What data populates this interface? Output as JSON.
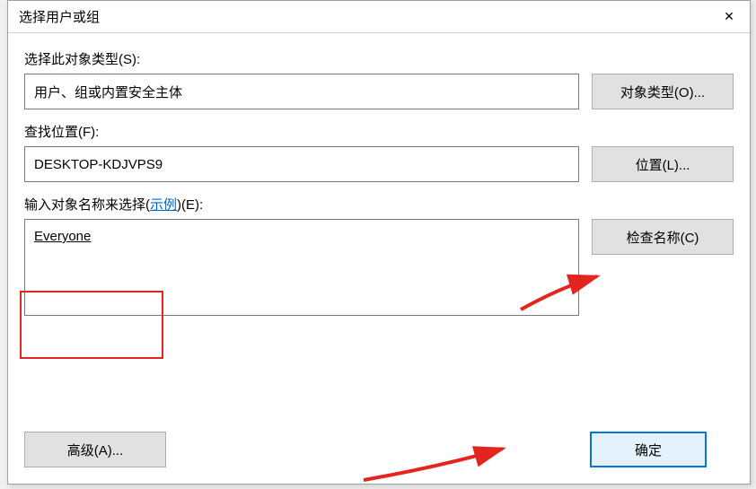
{
  "dialog": {
    "title": "选择用户或组",
    "close_icon": "✕"
  },
  "objectType": {
    "label": "选择此对象类型(S):",
    "value": "用户、组或内置安全主体",
    "button": "对象类型(O)..."
  },
  "location": {
    "label": "查找位置(F):",
    "value": "DESKTOP-KDJVPS9",
    "button": "位置(L)..."
  },
  "objectNames": {
    "label_prefix": "输入对象名称来选择(",
    "link": "示例",
    "label_suffix": ")(E):",
    "value": "Everyone",
    "button": "检查名称(C)"
  },
  "buttons": {
    "advanced": "高级(A)...",
    "ok": "确定"
  }
}
